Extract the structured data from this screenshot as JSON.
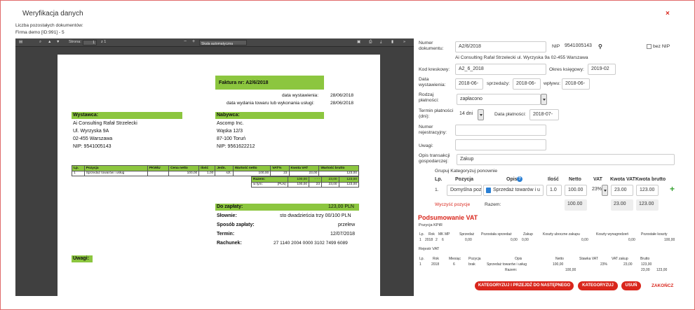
{
  "modal": {
    "title": "Weryfikacja danych",
    "close": "×",
    "remaining_label": "Liczba pozostałych dokumentów:",
    "firm": "Firma demo [ID:991] - 5"
  },
  "viewer": {
    "page_label": "Strona:",
    "page_value": "1",
    "page_total": "z 1",
    "zoom": "Skala automatyczna",
    "minus": "−",
    "plus": "+"
  },
  "invoice": {
    "title": "Faktura nr: A2/6/2018",
    "issue_label": "data wystawienia:",
    "issue_date": "28/06/2018",
    "delivery_label": "data wydania towaru lub wykonania usługi:",
    "delivery_date": "28/06/2018",
    "seller_title": "Wystawca:",
    "seller": [
      "Ai Consulting Rafał Strzelecki",
      "Ul. Wyrzyska 9A",
      "02-455 Warszawa",
      "NIP: 9541005143"
    ],
    "buyer_title": "Nabywca:",
    "buyer": [
      "Ascomp Inc.",
      "Wąska 12/3",
      "87-100 Toruń",
      "NIP: 9561622212"
    ],
    "table_headers": [
      "Lp.",
      "Pozycja",
      "PKWiU",
      "Cena netto",
      "Ilość",
      "Jedn.",
      "Wartość netto",
      "VAT%",
      "Kwota VAT",
      "Wartość brutto"
    ],
    "row": [
      "1",
      "Sprzedaż towarów i usług",
      "",
      "100,00",
      "1,00",
      "szt.",
      "100,00",
      "23",
      "23,00",
      "123,00"
    ],
    "sum_label": "Razem:",
    "sum": [
      "100,00",
      "- - -",
      "23,00",
      "123,00"
    ],
    "wtym_label": "w tym:",
    "wtym_cur": "(PLN)",
    "wtym": [
      "100,00",
      "23",
      "23,00",
      "123,00"
    ],
    "pay_label": "Do zapłaty:",
    "pay_value": "123,00 PLN",
    "words_label": "Słownie:",
    "words_value": "sto dwadzieścia trzy 00/100 PLN",
    "method_label": "Sposób zapłaty:",
    "method_value": "przelew",
    "due_label": "Termin:",
    "due_value": "12/07/2018",
    "account_label": "Rachunek:",
    "account_value": "27 1140 2004 0000 3102 7499 6089",
    "notes_label": "Uwagi:"
  },
  "form": {
    "doc_number_label": [
      "Numer",
      "dokumentu:"
    ],
    "doc_number": "A2/6/2018",
    "nip_label": "NIP:",
    "nip": "9541005143",
    "no_nip_label": "bez NIP",
    "seller_line": "Ai Consulting Rafał Strzelecki ul. Wyrzyska 9a 02-455 Warszawa",
    "barcode_label": "Kod kreskowy:",
    "barcode": "A2_6_2018",
    "period_label": "Okres księgowy:",
    "period": "2019-02",
    "issue_label": [
      "Data",
      "wystawienia:"
    ],
    "issue_date": "2018-06-",
    "sale_label": "sprzedaży:",
    "sale_date": "2018-06-",
    "receipt_label": "wpływu:",
    "receipt_date": "2018-06-",
    "payment_type_label": [
      "Rodzaj",
      "płatności:"
    ],
    "payment_type": "zapłacono",
    "payment_term_label": [
      "Termin płatności",
      "(dni):"
    ],
    "payment_term": "14 dni",
    "payment_date_label": "Data płatności:",
    "payment_date": "2018-07-",
    "reg_number_label": [
      "Numer",
      "rejestracyjny:"
    ],
    "reg_number": "",
    "notes_label": "Uwagi:",
    "notes": "",
    "desc_label": [
      "Opis transakcji",
      "gospodarczej:"
    ],
    "desc": "Zakup",
    "group_label": "Grupuj Kategoryzuj ponownie",
    "headers": [
      "Lp.",
      "Pozycja",
      "Opis",
      "Ilość",
      "Netto",
      "VAT",
      "Kwota VAT",
      "Kwota brutto"
    ],
    "pos_lp": "1.",
    "pos_name": "Domyślna poz",
    "pos_desc": "Sprzedaż towarów i u",
    "pos_qty": "1.0",
    "pos_net": "100.00",
    "pos_vat": "23%",
    "pos_vat_amount": "23.00",
    "pos_gross": "123.00",
    "clear_label": "Wyczyść pozycje",
    "sum_label": "Razem:",
    "sum_net": "100.00",
    "sum_vat": "23.00",
    "sum_gross": "123.00",
    "add": "+"
  },
  "summary": {
    "title": "Podsumowanie VAT",
    "kpir_title": "Pozycja KPiR",
    "kpir_headers": [
      "Lp.",
      "Rok",
      "MK",
      "MP",
      "Sprzedaż",
      "Pozostała sprzedaż",
      "Zakup",
      "Koszty uboczne zakupu",
      "Koszty wynagrodzeń",
      "Pozostałe koszty"
    ],
    "kpir_row": [
      "1",
      "2018",
      "2",
      "6",
      "0,00",
      "0,00",
      "0,00",
      "0,00",
      "0,00",
      "100,00"
    ],
    "vat_title": "Rejestr VAT",
    "vat_headers": [
      "Lp.",
      "Rok",
      "Miesiąc",
      "Pozycja",
      "Opis",
      "Netto",
      "Stawka VAT",
      "VAT zakup",
      "Brutto"
    ],
    "vat_row": [
      "1",
      "2018",
      "6",
      "brak",
      "Sprzedaż towarów i usług",
      "100,00",
      "23%",
      "23,00",
      "123,00"
    ],
    "vat_sum_label": "Razem:",
    "vat_sum": [
      "100,00",
      "23,00",
      "123,00"
    ]
  },
  "actions": {
    "categorize_next": "KATEGORYZUJ I PRZEJDŹ DO NASTĘPNEGO",
    "categorize": "KATEGORYZUJ",
    "delete": "USUŃ",
    "finish": "ZAKOŃCZ"
  },
  "colors": {
    "accent": "#d9261c",
    "invoice_green": "#8cc63f",
    "viewer_bg": "#404040"
  }
}
